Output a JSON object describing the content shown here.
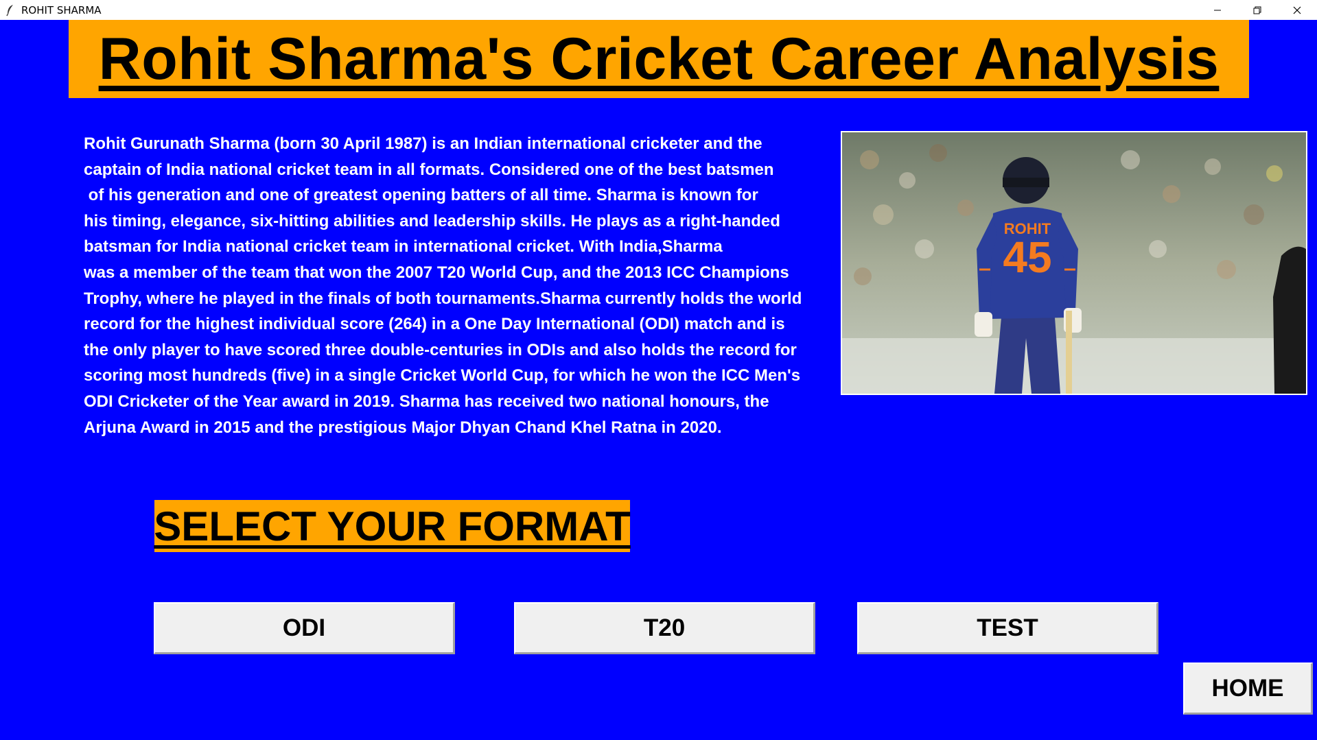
{
  "window": {
    "title": "ROHIT SHARMA",
    "controls": [
      "minimize-icon",
      "restore-icon",
      "close-icon"
    ]
  },
  "header": {
    "title": "Rohit Sharma's Cricket Career Analysis"
  },
  "bio": {
    "lines": [
      "Rohit Gurunath Sharma (born 30 April 1987) is an Indian international cricketer and the",
      "captain of India national cricket team in all formats. Considered one of the best batsmen",
      " of his generation and one of greatest opening batters of all time. Sharma is known for",
      "his timing, elegance, six-hitting abilities and leadership skills. He plays as a right-handed",
      "batsman for India national cricket team in international cricket. With India,Sharma",
      "was a member of the team that won the 2007 T20 World Cup, and the 2013 ICC Champions",
      "Trophy, where he played in the finals of both tournaments.Sharma currently holds the world",
      "record for the highest individual score (264) in a One Day International (ODI) match and is",
      "the only player to have scored three double-centuries in ODIs and also holds the record for",
      "scoring most hundreds (five) in a single Cricket World Cup, for which he won the ICC Men's",
      "ODI Cricketer of the Year award in 2019. Sharma has received two national honours, the",
      "Arjuna Award in 2015 and the prestigious Major Dhyan Chand Khel Ratna in 2020."
    ]
  },
  "photo": {
    "jersey_name": "ROHIT",
    "jersey_number": "45"
  },
  "format_section": {
    "label": "SELECT YOUR FORMAT",
    "buttons": {
      "odi": "ODI",
      "t20": "T20",
      "test": "TEST"
    }
  },
  "nav": {
    "home": "HOME"
  },
  "colors": {
    "background": "#0000ff",
    "accent": "#ffa500",
    "button": "#f0f0f0"
  }
}
